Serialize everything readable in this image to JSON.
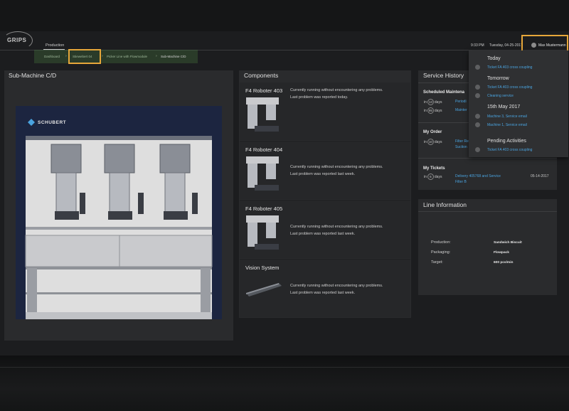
{
  "app": {
    "logo": "GRIPS",
    "tab": "Production"
  },
  "header": {
    "time": "9:33 PM",
    "date": "Tuesday, 04-25-2017",
    "user": "Max Mustermann"
  },
  "breadcrumb": [
    "Dashboard",
    "Stiewebert 04",
    "Picker Line with Flowmodule",
    "Sub-Machine C/D"
  ],
  "sub_machine": {
    "title": "Sub-Machine C/D",
    "brand": "SCHUBERT"
  },
  "components": {
    "title": "Components",
    "items": [
      {
        "name": "F4 Roboter 403",
        "line1": "Currently running without encountering any problems.",
        "line2": "Last problem was reported today."
      },
      {
        "name": "F4 Roboter 404",
        "line1": "Currently running without encountering any problems.",
        "line2": "Last problem was reported last week."
      },
      {
        "name": "F4 Roboter 405",
        "line1": "Currently running without encountering any problems.",
        "line2": "Last problem was reported last week."
      },
      {
        "name": "Vision System",
        "line1": "Currently running without encountering any problems.",
        "line2": "Last problem was reported last week."
      }
    ]
  },
  "service": {
    "title": "Service History",
    "scheduled": {
      "heading": "Scheduled Maintena",
      "rows": [
        {
          "in": "in",
          "num": "13",
          "unit": "days",
          "link": "Periodi"
        },
        {
          "in": "in",
          "num": "95",
          "unit": "days",
          "link": "Mainter"
        }
      ]
    },
    "order": {
      "heading": "My Order",
      "rows": [
        {
          "in": "in",
          "num": "10",
          "unit": "days",
          "link": "Filter Re",
          "link2": "Suction"
        }
      ]
    },
    "tickets": {
      "heading": "My Tickets",
      "rows": [
        {
          "in": "in",
          "num": "6",
          "unit": "days",
          "link": "Delivery 405768 and Service",
          "link2": "Filter B",
          "date": "05-14-2017"
        }
      ]
    }
  },
  "line_info": {
    "title": "Line Information",
    "rows": [
      {
        "label": "Production:",
        "value": "Sandwich Biscuit"
      },
      {
        "label": "Packaging:",
        "value": "Flowpack"
      },
      {
        "label": "Target:",
        "value": "600 pcs/min"
      }
    ]
  },
  "dropdown": {
    "groups": [
      {
        "heading": "Today",
        "items": [
          "Ticket FA 403 cross coupling"
        ]
      },
      {
        "heading": "Tomorrow",
        "items": [
          "Ticket FA 403 cross coupling",
          "Cleaning service"
        ]
      },
      {
        "heading": "15th May 2017",
        "items": [
          "Machine 3, Service email",
          "Machine 1, Service email"
        ]
      },
      {
        "heading": "Pending Activities",
        "items": [
          "Ticket FA 403 cross coupling"
        ]
      }
    ]
  },
  "colors": {
    "accent": "#e7a73a",
    "link": "#4aa3df",
    "crumb_bg": "#3e5a3a",
    "panel": "#2a2b2d"
  }
}
